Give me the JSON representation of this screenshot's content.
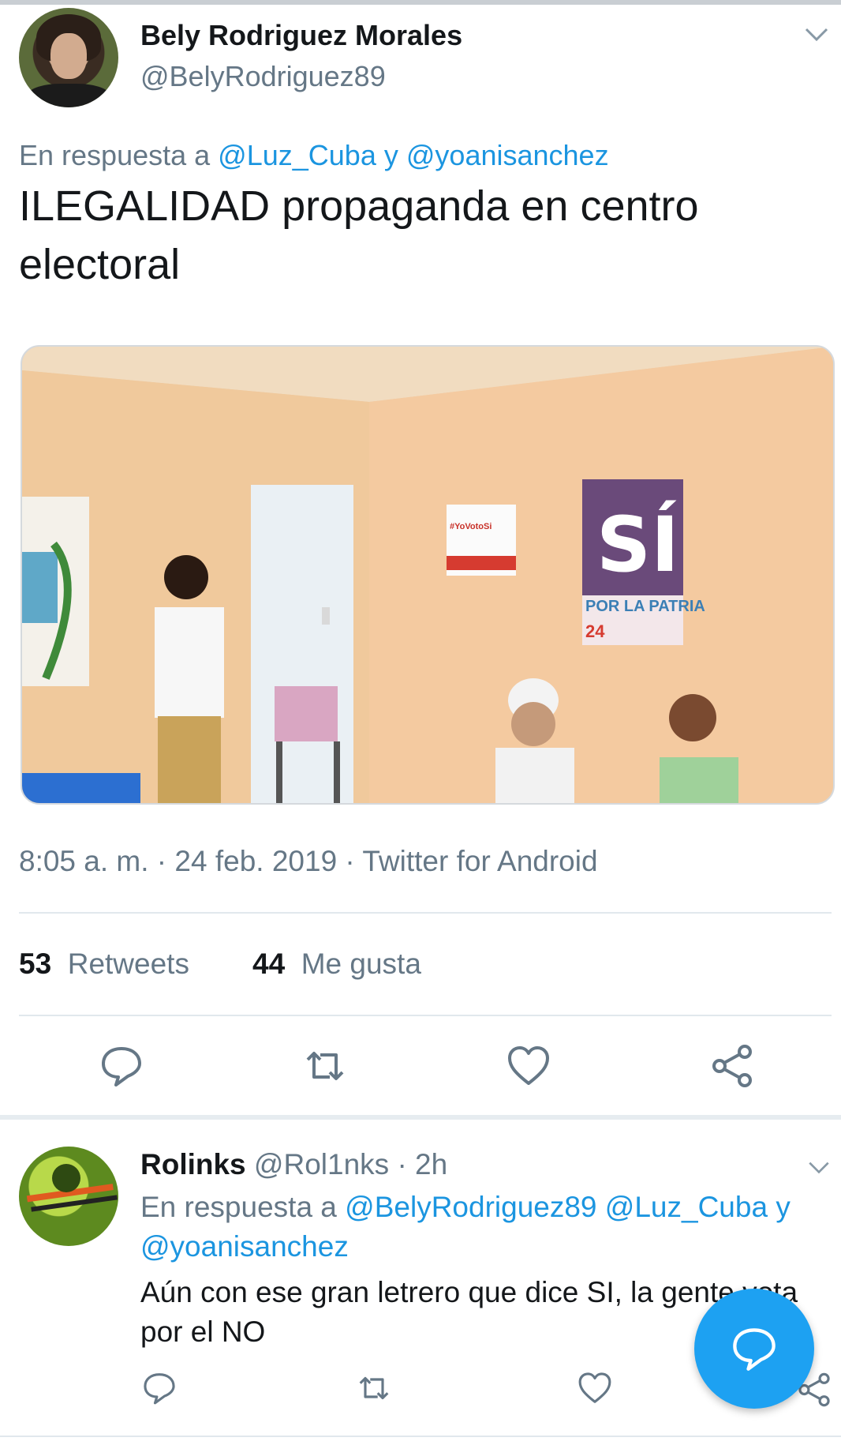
{
  "tweet": {
    "author_name": "Bely Rodriguez Morales",
    "author_handle": "@BelyRodriguez89",
    "reply_prefix": "En respuesta a",
    "reply_mention_1": "@Luz_Cuba",
    "reply_and": "y",
    "reply_mention_2": "@yoanisanchez",
    "text": "ILEGALIDAD propaganda en centro electoral",
    "meta": "8:05 a. m. · 24 feb. 2019 · Twitter for Android",
    "retweets_count": "53",
    "retweets_label": "Retweets",
    "likes_count": "44",
    "likes_label": "Me gusta",
    "photo": {
      "poster_small_tag": "#YoVotoSi",
      "poster_big_word": "SÍ",
      "poster_big_sub": "POR LA PATRIA",
      "poster_big_num": "24"
    }
  },
  "reply": {
    "author_name": "Rolinks",
    "author_handle": "@Rol1nks",
    "time": "· 2h",
    "reply_prefix": "En respuesta a",
    "reply_mention_1": "@BelyRodriguez89",
    "reply_mention_2": "@Luz_Cuba",
    "reply_and": "y",
    "reply_mention_3": "@yoanisanchez",
    "text": "Aún con ese gran letrero que dice SI, la gente vota por el NO"
  },
  "icons": {
    "reply": "reply-icon",
    "retweet": "retweet-icon",
    "like": "heart-icon",
    "share": "share-icon",
    "caret": "chevron-down-icon",
    "compose": "compose-reply-icon"
  },
  "colors": {
    "link": "#1b95e0",
    "secondary": "#657786",
    "fab": "#1da1f2"
  }
}
